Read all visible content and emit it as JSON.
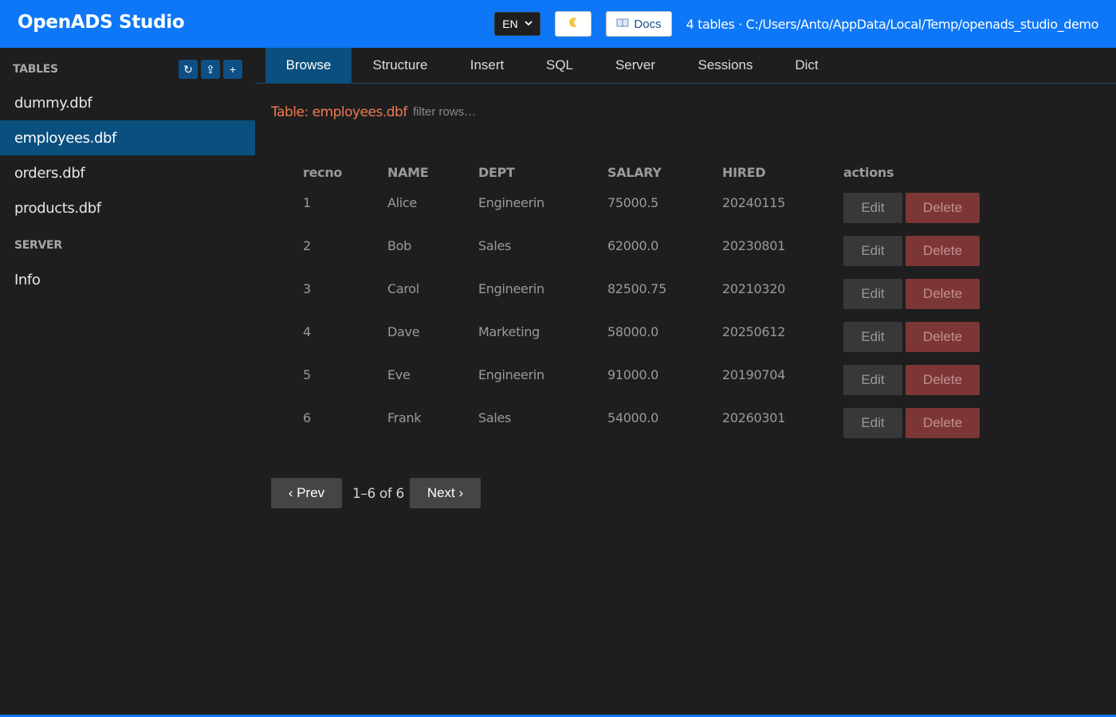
{
  "header": {
    "title": "OpenADS Studio",
    "language": "EN",
    "theme_icon": "crescent-moon",
    "docs_icon": "open-book",
    "docs_label": "Docs",
    "status": "4 tables · C:/Users/Anto/AppData/Local/Temp/openads_studio_demo",
    "accent_color": "#0d77f7"
  },
  "sidebar": {
    "tables_label": "TABLES",
    "tools": [
      {
        "icon": "refresh",
        "glyph": "↻"
      },
      {
        "icon": "upload",
        "glyph": "⇪"
      },
      {
        "icon": "add",
        "glyph": "+"
      }
    ],
    "tables": [
      "dummy.dbf",
      "employees.dbf",
      "orders.dbf",
      "products.dbf"
    ],
    "active_table": "employees.dbf",
    "server_label": "SERVER",
    "server_items": [
      "Info"
    ]
  },
  "tabs": [
    "Browse",
    "Structure",
    "Insert",
    "SQL",
    "Server",
    "Sessions",
    "Dict"
  ],
  "active_tab": "Browse",
  "main": {
    "table_title": "Table: employees.dbf",
    "filter_placeholder": "filter rows…",
    "columns": [
      "recno",
      "NAME",
      "DEPT",
      "SALARY",
      "HIRED",
      "actions"
    ],
    "rows": [
      {
        "recno": "1",
        "NAME": "Alice",
        "DEPT": "Engineerin",
        "SALARY": "75000.5",
        "HIRED": "20240115"
      },
      {
        "recno": "2",
        "NAME": "Bob",
        "DEPT": "Sales",
        "SALARY": "62000.0",
        "HIRED": "20230801"
      },
      {
        "recno": "3",
        "NAME": "Carol",
        "DEPT": "Engineerin",
        "SALARY": "82500.75",
        "HIRED": "20210320"
      },
      {
        "recno": "4",
        "NAME": "Dave",
        "DEPT": "Marketing",
        "SALARY": "58000.0",
        "HIRED": "20250612"
      },
      {
        "recno": "5",
        "NAME": "Eve",
        "DEPT": "Engineerin",
        "SALARY": "91000.0",
        "HIRED": "20190704"
      },
      {
        "recno": "6",
        "NAME": "Frank",
        "DEPT": "Sales",
        "SALARY": "54000.0",
        "HIRED": "20260301"
      }
    ],
    "edit_label": "Edit",
    "delete_label": "Delete"
  },
  "pager": {
    "prev_label": "‹ Prev",
    "info": "1–6 of 6",
    "next_label": "Next ›"
  }
}
